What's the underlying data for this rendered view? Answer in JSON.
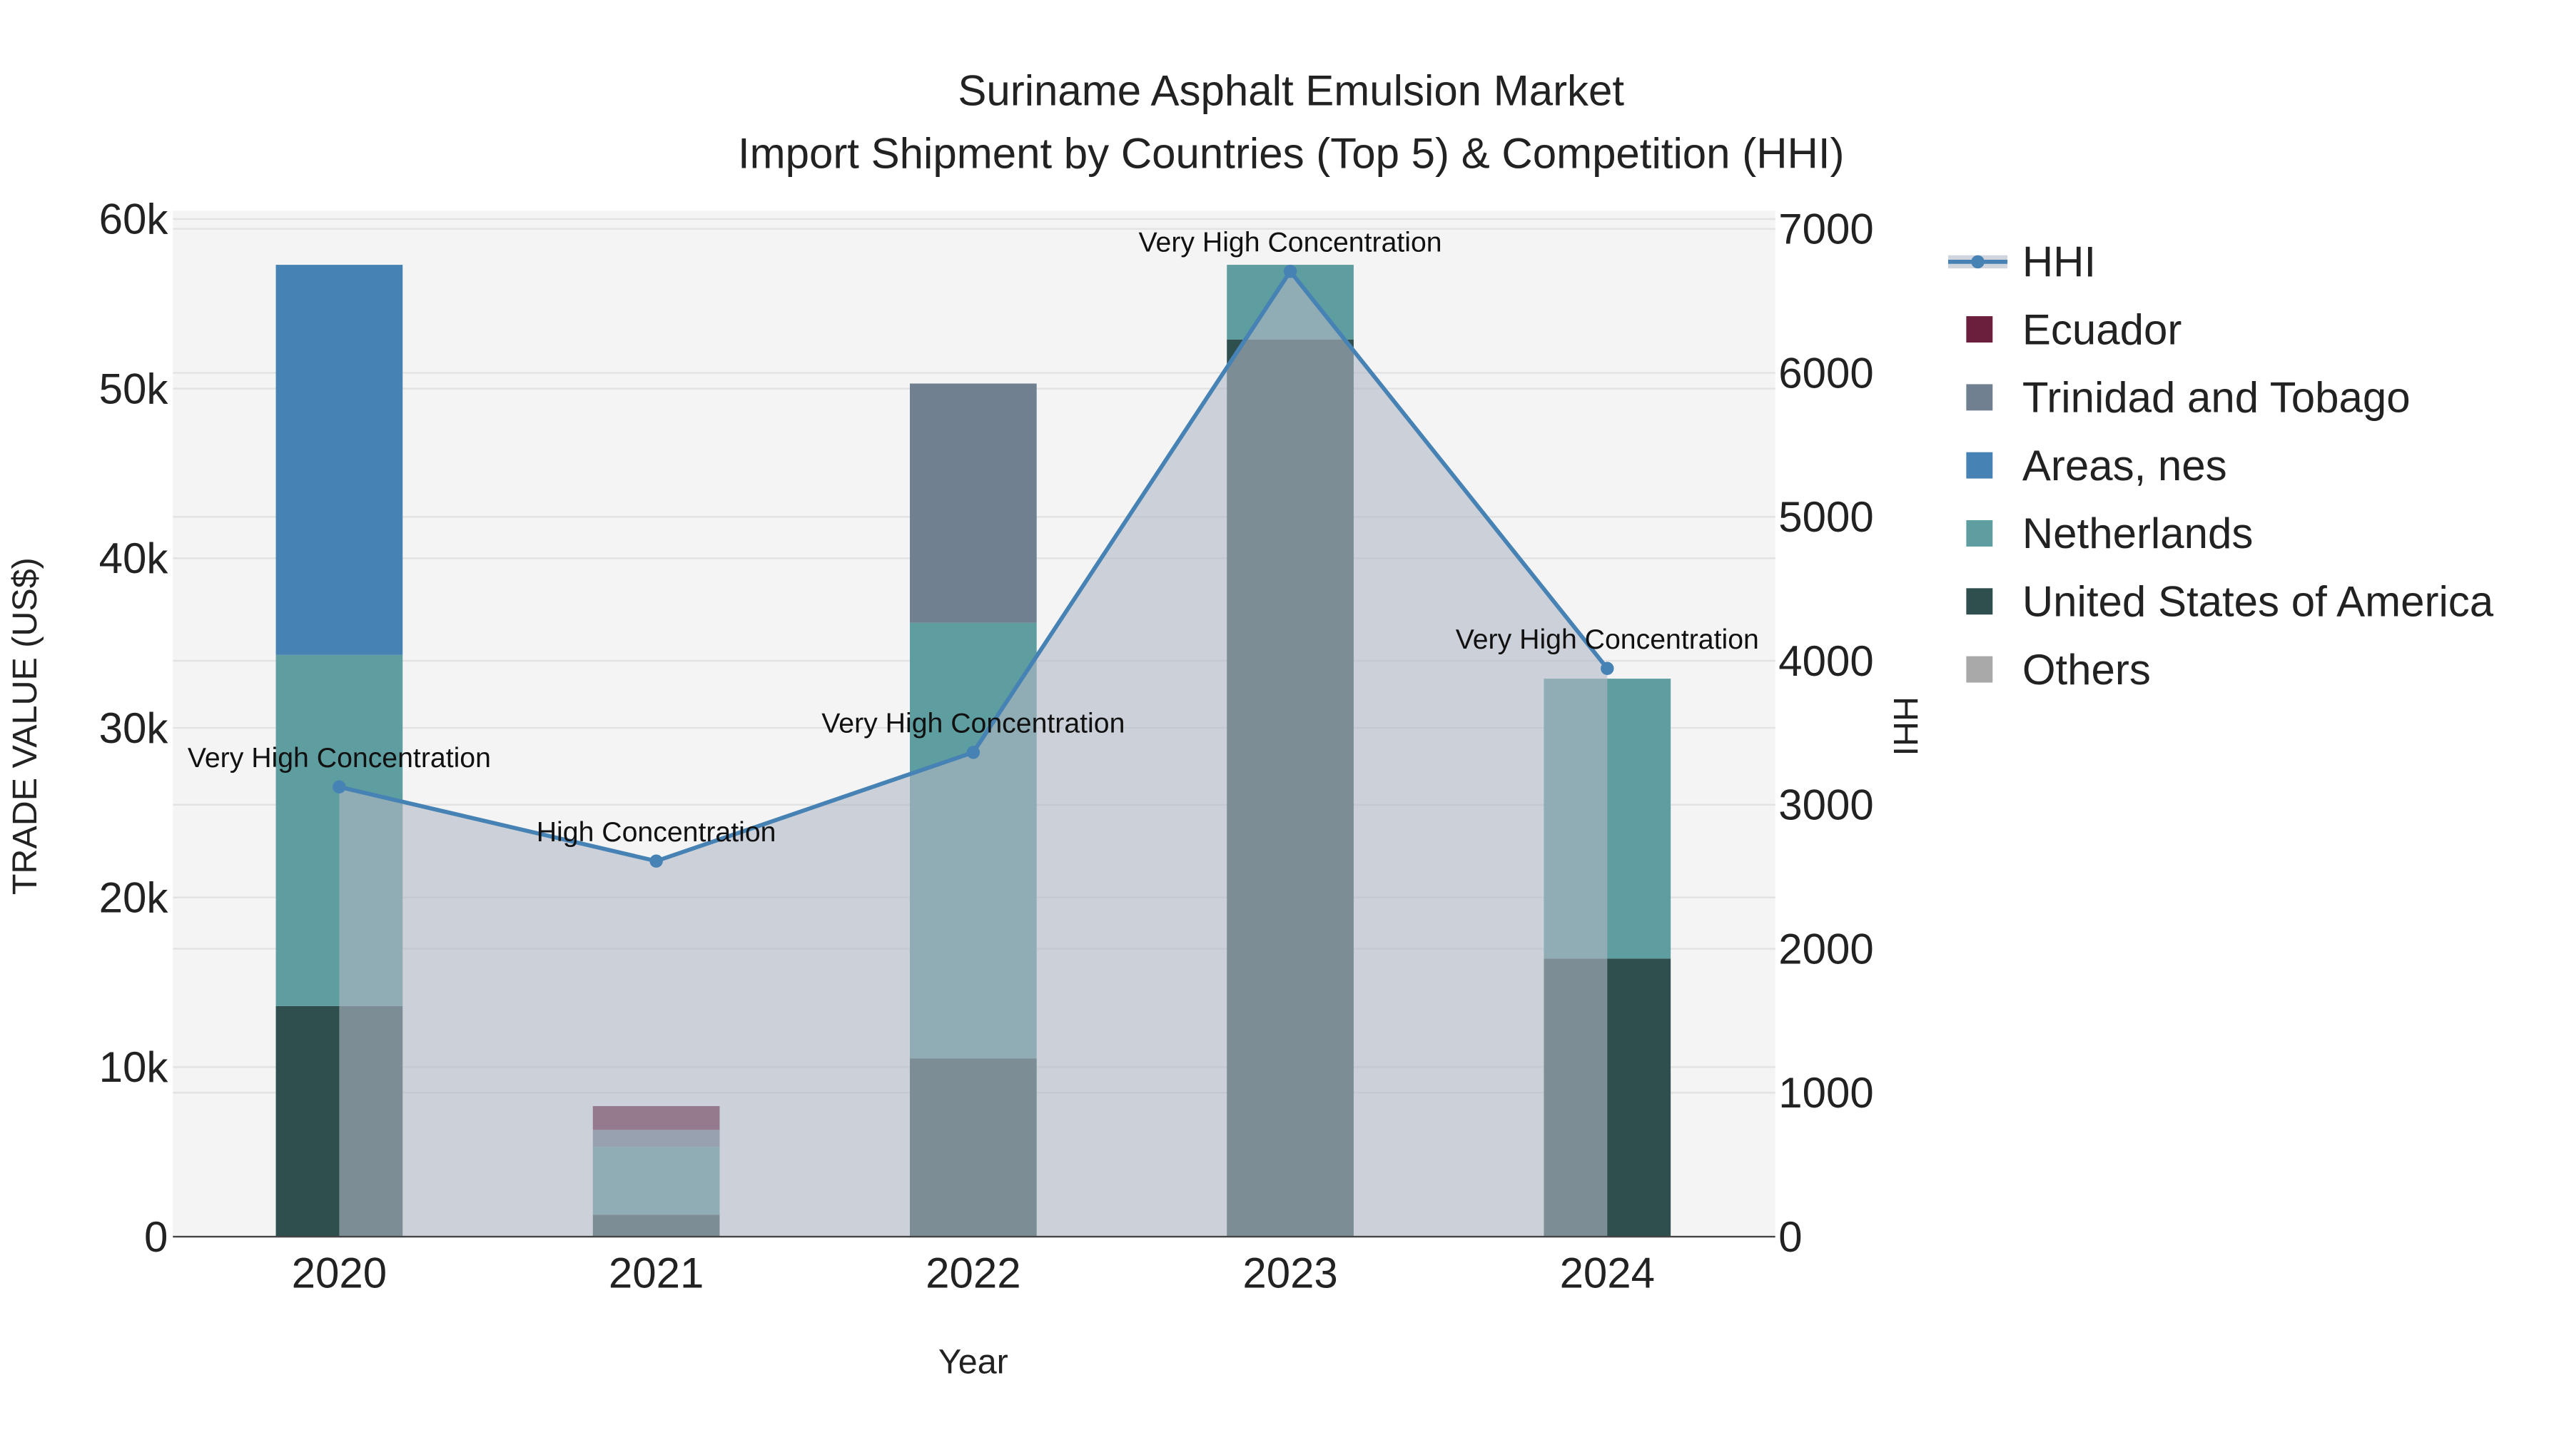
{
  "chart_data": {
    "type": "bar",
    "title": "Suriname Asphalt Emulsion Market",
    "subtitle": "Import Shipment by Countries (Top 5) & Competition (HHI)",
    "xlabel": "Year",
    "ylabel": "TRADE VALUE (US$)",
    "y2label": "HHI",
    "categories": [
      "2020",
      "2021",
      "2022",
      "2023",
      "2024"
    ],
    "ylim": [
      0,
      60000
    ],
    "y2lim": [
      0,
      7000
    ],
    "yticks": [
      {
        "v": 0,
        "label": "0"
      },
      {
        "v": 10000,
        "label": "10k"
      },
      {
        "v": 20000,
        "label": "20k"
      },
      {
        "v": 30000,
        "label": "30k"
      },
      {
        "v": 40000,
        "label": "40k"
      },
      {
        "v": 50000,
        "label": "50k"
      },
      {
        "v": 60000,
        "label": "60k"
      }
    ],
    "y2ticks": [
      {
        "v": 0,
        "label": "0"
      },
      {
        "v": 1000,
        "label": "1000"
      },
      {
        "v": 2000,
        "label": "2000"
      },
      {
        "v": 3000,
        "label": "3000"
      },
      {
        "v": 4000,
        "label": "4000"
      },
      {
        "v": 5000,
        "label": "5000"
      },
      {
        "v": 6000,
        "label": "6000"
      },
      {
        "v": 7000,
        "label": "7000"
      }
    ],
    "stack_order": [
      "United States of America",
      "Netherlands",
      "Areas, nes",
      "Trinidad and Tobago",
      "Ecuador",
      "Others"
    ],
    "series": [
      {
        "name": "Ecuador",
        "color": "#6b1f3d",
        "values": [
          0,
          1400,
          0,
          0,
          0
        ]
      },
      {
        "name": "Trinidad and Tobago",
        "color": "#708090",
        "values": [
          0,
          1000,
          14100,
          0,
          0
        ]
      },
      {
        "name": "Areas, nes",
        "color": "#4682b4",
        "values": [
          23000,
          0,
          0,
          0,
          0
        ]
      },
      {
        "name": "Netherlands",
        "color": "#5f9ea0",
        "values": [
          20700,
          4000,
          25700,
          4400,
          16500
        ]
      },
      {
        "name": "United States of America",
        "color": "#2f4f4f",
        "values": [
          13600,
          1300,
          10500,
          52900,
          16400
        ]
      },
      {
        "name": "Others",
        "color": "#a9a9a9",
        "values": [
          0,
          0,
          0,
          0,
          0
        ]
      }
    ],
    "hhi": {
      "name": "HHI",
      "color": "#4682b4",
      "values": [
        3124,
        2609,
        3364,
        6705,
        3947
      ],
      "annotations": [
        "Very High Concentration",
        "High Concentration",
        "Very High Concentration",
        "Very High Concentration",
        "Very High Concentration"
      ]
    },
    "legend_position": "right",
    "grid": true
  }
}
